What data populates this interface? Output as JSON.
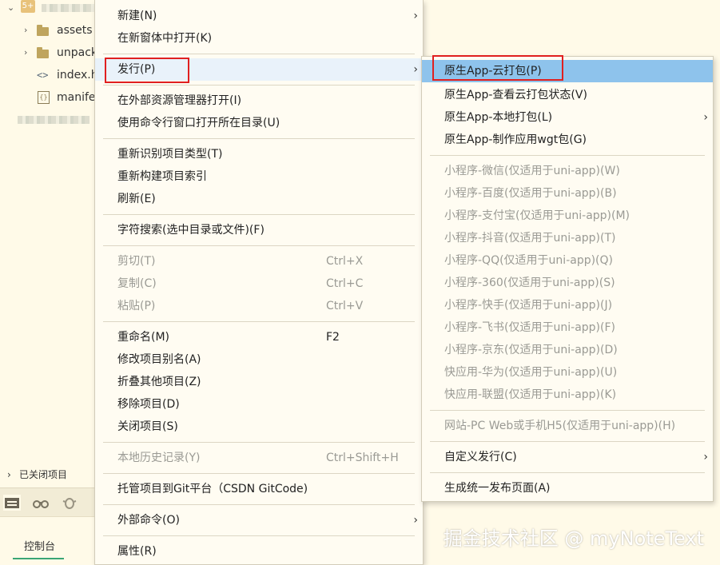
{
  "tree": {
    "root_badge": "5+",
    "items": [
      {
        "label": "assets",
        "icon": "folder-icon"
      },
      {
        "label": "unpack",
        "icon": "folder-icon"
      },
      {
        "label": "index.h",
        "icon": "code-file-icon"
      },
      {
        "label": "manife",
        "icon": "json-file-icon"
      }
    ],
    "closed_projects_label": "已关闭项目",
    "console_label": "控制台"
  },
  "context_menu": {
    "items": [
      {
        "label": "新建(N)",
        "shortcut": "",
        "submenu": true,
        "disabled": false
      },
      {
        "label": "在新窗体中打开(K)",
        "shortcut": "",
        "submenu": false,
        "disabled": false
      },
      {
        "label": "发行(P)",
        "shortcut": "",
        "submenu": true,
        "disabled": false
      },
      {
        "label": "在外部资源管理器打开(I)",
        "shortcut": "",
        "submenu": false,
        "disabled": false
      },
      {
        "label": "使用命令行窗口打开所在目录(U)",
        "shortcut": "",
        "submenu": false,
        "disabled": false
      },
      {
        "label": "重新识别项目类型(T)",
        "shortcut": "",
        "submenu": false,
        "disabled": false
      },
      {
        "label": "重新构建项目索引",
        "shortcut": "",
        "submenu": false,
        "disabled": false
      },
      {
        "label": "刷新(E)",
        "shortcut": "",
        "submenu": false,
        "disabled": false
      },
      {
        "label": "字符搜索(选中目录或文件)(F)",
        "shortcut": "",
        "submenu": false,
        "disabled": false
      },
      {
        "label": "剪切(T)",
        "shortcut": "Ctrl+X",
        "submenu": false,
        "disabled": true
      },
      {
        "label": "复制(C)",
        "shortcut": "Ctrl+C",
        "submenu": false,
        "disabled": true
      },
      {
        "label": "粘贴(P)",
        "shortcut": "Ctrl+V",
        "submenu": false,
        "disabled": true
      },
      {
        "label": "重命名(M)",
        "shortcut": "F2",
        "submenu": false,
        "disabled": false
      },
      {
        "label": "修改项目别名(A)",
        "shortcut": "",
        "submenu": false,
        "disabled": false
      },
      {
        "label": "折叠其他项目(Z)",
        "shortcut": "",
        "submenu": false,
        "disabled": false
      },
      {
        "label": "移除项目(D)",
        "shortcut": "",
        "submenu": false,
        "disabled": false
      },
      {
        "label": "关闭项目(S)",
        "shortcut": "",
        "submenu": false,
        "disabled": false
      },
      {
        "label": "本地历史记录(Y)",
        "shortcut": "Ctrl+Shift+H",
        "submenu": false,
        "disabled": true
      },
      {
        "label": "托管项目到Git平台（CSDN GitCode)",
        "shortcut": "",
        "submenu": false,
        "disabled": false
      },
      {
        "label": "外部命令(O)",
        "shortcut": "",
        "submenu": true,
        "disabled": false
      },
      {
        "label": "属性(R)",
        "shortcut": "",
        "submenu": false,
        "disabled": false
      }
    ]
  },
  "publish_submenu": {
    "items": [
      {
        "label": "原生App-云打包(P)",
        "submenu": false,
        "disabled": false,
        "highlighted": true
      },
      {
        "label": "原生App-查看云打包状态(V)",
        "submenu": false,
        "disabled": false
      },
      {
        "label": "原生App-本地打包(L)",
        "submenu": true,
        "disabled": false
      },
      {
        "label": "原生App-制作应用wgt包(G)",
        "submenu": false,
        "disabled": false
      },
      {
        "label": "小程序-微信(仅适用于uni-app)(W)",
        "submenu": false,
        "disabled": true
      },
      {
        "label": "小程序-百度(仅适用于uni-app)(B)",
        "submenu": false,
        "disabled": true
      },
      {
        "label": "小程序-支付宝(仅适用于uni-app)(M)",
        "submenu": false,
        "disabled": true
      },
      {
        "label": "小程序-抖音(仅适用于uni-app)(T)",
        "submenu": false,
        "disabled": true
      },
      {
        "label": "小程序-QQ(仅适用于uni-app)(Q)",
        "submenu": false,
        "disabled": true
      },
      {
        "label": "小程序-360(仅适用于uni-app)(S)",
        "submenu": false,
        "disabled": true
      },
      {
        "label": "小程序-快手(仅适用于uni-app)(J)",
        "submenu": false,
        "disabled": true
      },
      {
        "label": "小程序-飞书(仅适用于uni-app)(F)",
        "submenu": false,
        "disabled": true
      },
      {
        "label": "小程序-京东(仅适用于uni-app)(D)",
        "submenu": false,
        "disabled": true
      },
      {
        "label": "快应用-华为(仅适用于uni-app)(U)",
        "submenu": false,
        "disabled": true
      },
      {
        "label": "快应用-联盟(仅适用于uni-app)(K)",
        "submenu": false,
        "disabled": true
      },
      {
        "label": "网站-PC Web或手机H5(仅适用于uni-app)(H)",
        "submenu": false,
        "disabled": true
      },
      {
        "label": "自定义发行(C)",
        "submenu": true,
        "disabled": false
      },
      {
        "label": "生成统一发布页面(A)",
        "submenu": false,
        "disabled": false
      }
    ]
  },
  "colors": {
    "highlight": "#8ec3ec",
    "annotation_box": "#e02020",
    "background": "#fffae8"
  },
  "watermark": "掘金技术社区 @ myNoteText"
}
